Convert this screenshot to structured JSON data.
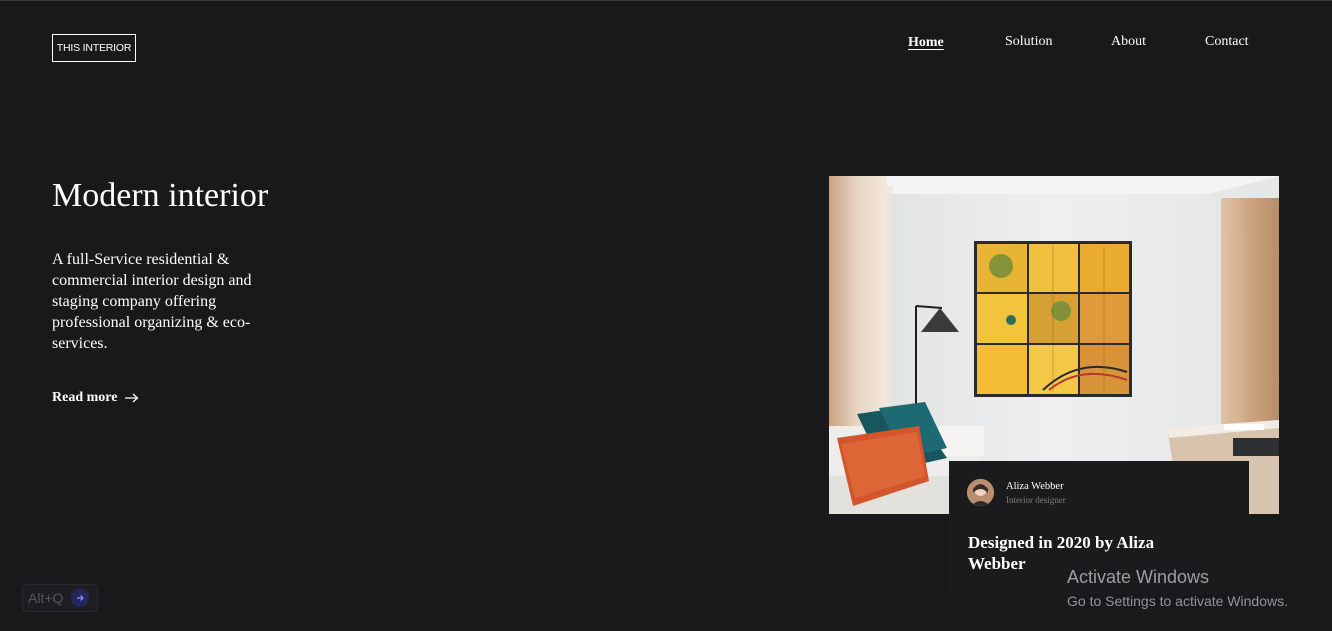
{
  "brand": {
    "logo_text": "THIS INTERIOR"
  },
  "nav": {
    "items": [
      {
        "label": "Home",
        "active": true
      },
      {
        "label": "Solution",
        "active": false
      },
      {
        "label": "About",
        "active": false
      },
      {
        "label": "Contact",
        "active": false
      }
    ]
  },
  "hero": {
    "title": "Modern interior",
    "description": "A full-Service residential & commercial interior design and staging company offering professional organizing & eco-services.",
    "cta_label": "Read more",
    "cta_icon": "arrow-right-icon"
  },
  "feature_card": {
    "author_name": "Aliza Webber",
    "author_role": "Interior designer",
    "heading": "Designed in 2020 by Aliza Webber"
  },
  "os_overlay": {
    "activate_title": "Activate Windows",
    "activate_subtitle": "Go to Settings to activate Windows.",
    "shortcut_label": "Alt+Q"
  },
  "colors": {
    "background": "#19191b",
    "text": "#ffffff",
    "card": "#1b1b1d",
    "muted": "#7b7b7f"
  }
}
